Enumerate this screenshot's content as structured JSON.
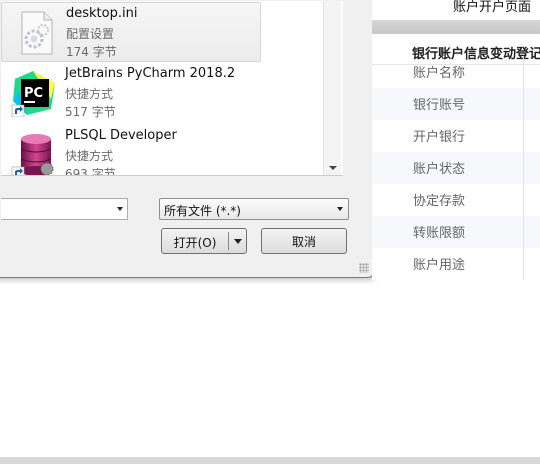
{
  "files": [
    {
      "name": "desktop.ini",
      "type": "配置设置",
      "size": "174 字节",
      "icon": "settings-file-icon",
      "selected": true
    },
    {
      "name": "JetBrains PyCharm 2018.2",
      "type": "快捷方式",
      "size": "517 字节",
      "icon": "pycharm-icon"
    },
    {
      "name": "PLSQL Developer",
      "type": "快捷方式",
      "size": "693 字节",
      "icon": "plsql-developer-icon"
    }
  ],
  "filter": {
    "value": "所有文件 (*.*)"
  },
  "buttons": {
    "open": "打开(O)",
    "cancel": "取消"
  },
  "web": {
    "title": "账户开户页面",
    "table_header": "银行账户信息变动登记",
    "rows": [
      "账户名称",
      "银行账号",
      "开户银行",
      "账户状态",
      "协定存款",
      "转账限额",
      "账户用途"
    ]
  }
}
